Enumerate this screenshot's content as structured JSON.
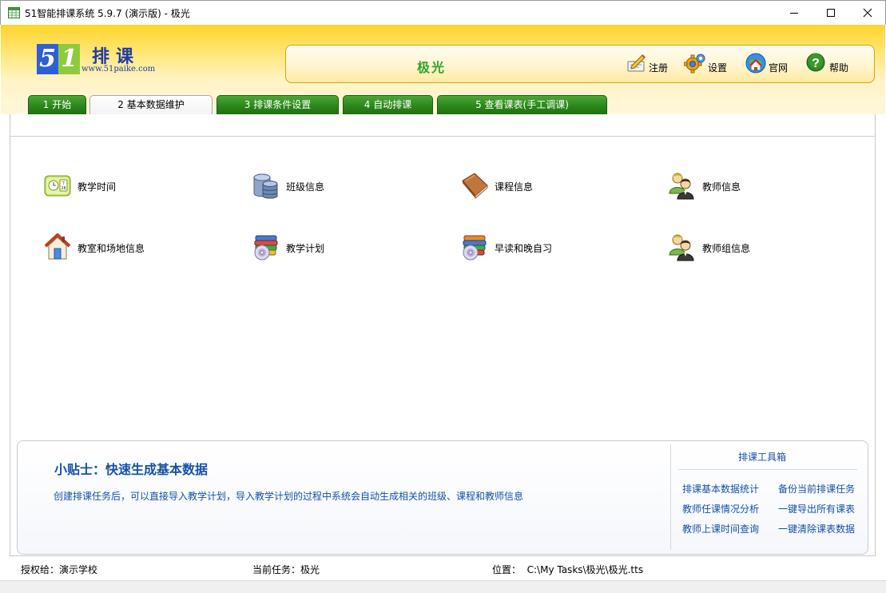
{
  "window": {
    "title": "51智能排课系统 5.9.7 (演示版) - 极光",
    "controls": [
      "minimize-icon",
      "maximize-icon",
      "close-icon"
    ]
  },
  "logo": {
    "digit_5": "5",
    "digit_1": "1",
    "name": "排课",
    "url": "www.51paike.com"
  },
  "header": {
    "task_name": "极光",
    "buttons": [
      {
        "label": "注册",
        "icon": "register-icon"
      },
      {
        "label": "设置",
        "icon": "gear-icon"
      },
      {
        "label": "官网",
        "icon": "home-globe-icon"
      },
      {
        "label": "帮助",
        "icon": "help-icon"
      }
    ]
  },
  "tabs": [
    {
      "label": "1 开始",
      "active": false
    },
    {
      "label": "2 基本数据维护",
      "active": true
    },
    {
      "label": "3 排课条件设置",
      "active": false
    },
    {
      "label": "4 自动排课",
      "active": false
    },
    {
      "label": "5 查看课表(手工调课)",
      "active": false
    }
  ],
  "functions": [
    {
      "label": "教学时间",
      "icon": "calendar-icon"
    },
    {
      "label": "班级信息",
      "icon": "database-icon"
    },
    {
      "label": "课程信息",
      "icon": "book-icon"
    },
    {
      "label": "教师信息",
      "icon": "users-icon"
    },
    {
      "label": "教室和场地信息",
      "icon": "house-icon"
    },
    {
      "label": "教学计划",
      "icon": "books-cd-icon"
    },
    {
      "label": "早读和晚自习",
      "icon": "books-cd-icon"
    },
    {
      "label": "教师组信息",
      "icon": "users-icon"
    }
  ],
  "tip": {
    "title": "小贴士：快速生成基本数据",
    "body": "创建排课任务后，可以直接导入教学计划，导入教学计划的过程中系统会自动生成相关的班级、课程和教师信息"
  },
  "toolbox": {
    "title": "排课工具箱",
    "links": [
      "排课基本数据统计",
      "备份当前排课任务",
      "教师任课情况分析",
      "一键导出所有课表",
      "教师上课时间查询",
      "一键清除课表数据"
    ]
  },
  "status": {
    "licensee": "授权给：演示学校",
    "current_task": "当前任务：极光",
    "location": "位置：  C:\\My Tasks\\极光\\极光.tts"
  },
  "colors": {
    "tab_green": "#2e8a1c",
    "header_gold": "#ffd42a",
    "link_blue": "#1450a8",
    "task_green": "#2fa52f"
  }
}
